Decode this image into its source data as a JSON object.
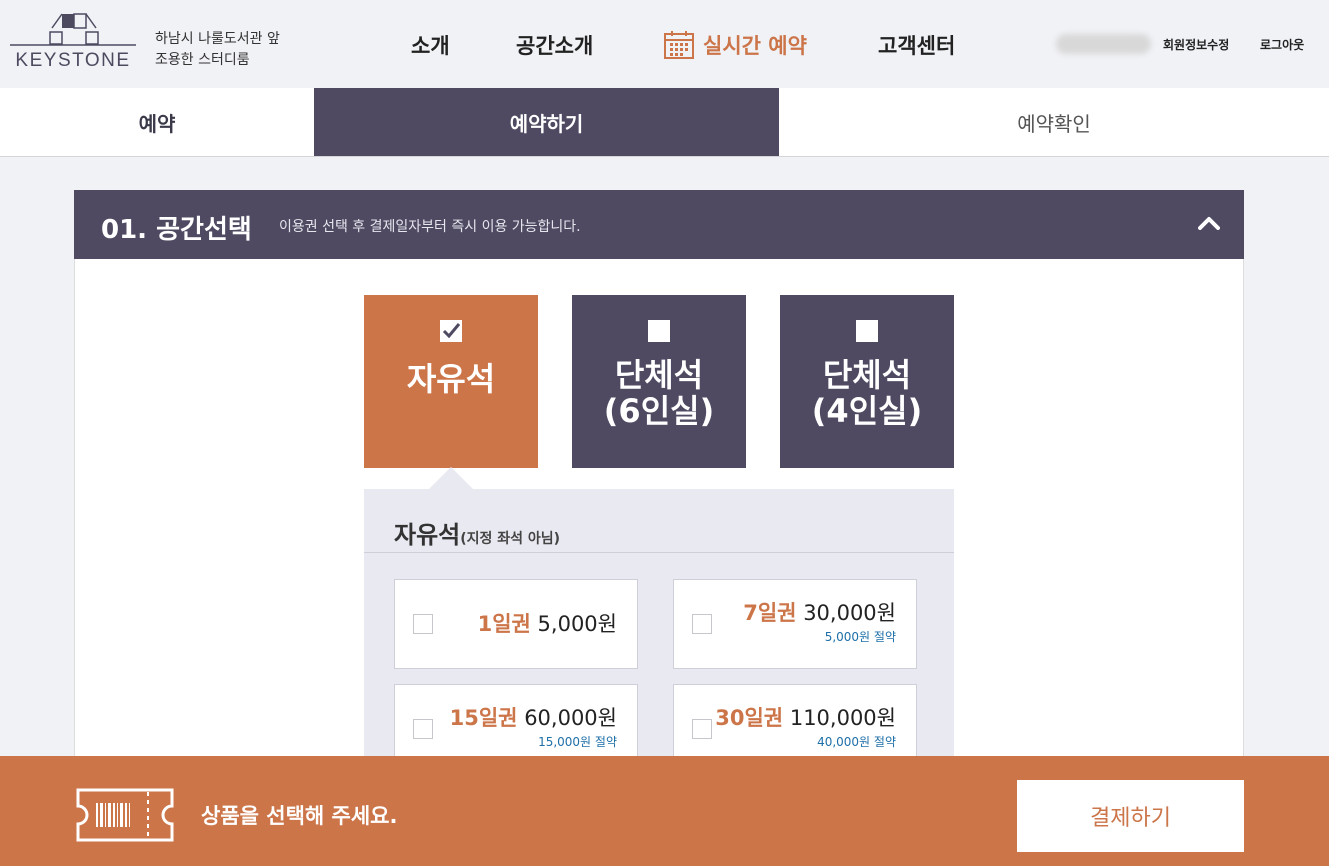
{
  "brand": {
    "logo_text": "KEYSTONE",
    "tagline_1": "하남시 나룰도서관 앞",
    "tagline_2": "조용한 스터디룸"
  },
  "nav": {
    "intro": "소개",
    "space": "공간소개",
    "realtime": "실시간 예약",
    "support": "고객센터"
  },
  "user": {
    "edit_profile": "회원정보수정",
    "logout": "로그아웃"
  },
  "tabs": [
    {
      "label": "예약"
    },
    {
      "label": "예약하기"
    },
    {
      "label": "예약확인"
    }
  ],
  "section": {
    "title": "01. 공간선택",
    "subtitle": "이용권 선택 후 결제일자부터 즉시 이용 가능합니다."
  },
  "options": [
    {
      "line1": "자유석",
      "line2": "",
      "selected": true
    },
    {
      "line1": "단체석",
      "line2": "(6인실)",
      "selected": false
    },
    {
      "line1": "단체석",
      "line2": "(4인실)",
      "selected": false
    }
  ],
  "panel": {
    "title": "자유석",
    "title_note": "(지정 좌석 아님)"
  },
  "plans": [
    {
      "days": "1일권",
      "price": "5,000원",
      "save": ""
    },
    {
      "days": "7일권",
      "price": "30,000원",
      "save": "5,000원 절약"
    },
    {
      "days": "15일권",
      "price": "60,000원",
      "save": "15,000원 절약"
    },
    {
      "days": "30일권",
      "price": "110,000원",
      "save": "40,000원 절약"
    }
  ],
  "bottom": {
    "message": "상품을 선택해 주세요.",
    "pay_button": "결제하기"
  },
  "colors": {
    "accent": "#cc7549",
    "dark": "#4f4a62",
    "panel": "#e9e9f1",
    "save_text": "#1e6fa8"
  }
}
